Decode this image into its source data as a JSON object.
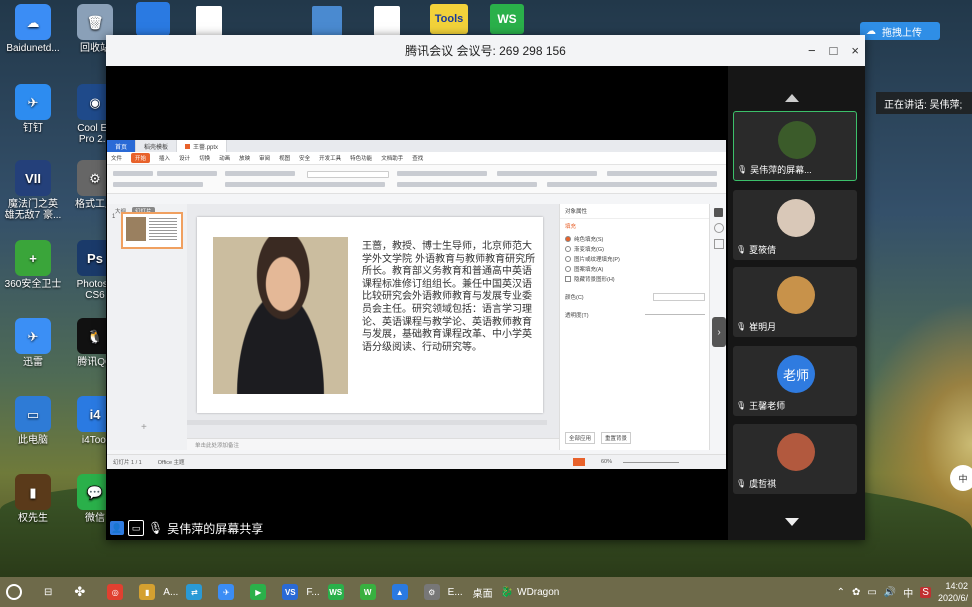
{
  "desktop": {
    "top_partial_icons": [
      "Tools",
      "WS"
    ],
    "icons": [
      {
        "name": "baidunetdisk",
        "label": "Baidunetd...",
        "color": "#3b8df5",
        "glyph": "☁"
      },
      {
        "name": "recycle-bin",
        "label": "回收站",
        "color": "#8aa0b8",
        "glyph": "🗑"
      },
      {
        "name": "dingding",
        "label": "钉钉",
        "color": "#2d8cf0",
        "glyph": "✈"
      },
      {
        "name": "cooledit",
        "label": "Cool Ed\nPro 2.1",
        "color": "#1f4a8a",
        "glyph": "◉"
      },
      {
        "name": "magic-gate",
        "label": "魔法门之英\n雄无敌7 豪...",
        "color": "#24407a",
        "glyph": "VII"
      },
      {
        "name": "format-factory",
        "label": "格式工厂",
        "color": "#666",
        "glyph": "⚙"
      },
      {
        "name": "360-safe",
        "label": "360安全卫士",
        "color": "#3aa53a",
        "glyph": "+"
      },
      {
        "name": "photoshop",
        "label": "Photosh\nCS6",
        "color": "#1a3a6a",
        "glyph": "Ps"
      },
      {
        "name": "xunlei",
        "label": "迅雷",
        "color": "#3b8ff5",
        "glyph": "✈"
      },
      {
        "name": "tencent-qq",
        "label": "腾讯QQ",
        "color": "#111",
        "glyph": "🐧"
      },
      {
        "name": "this-pc",
        "label": "此电脑",
        "color": "#2e7bd6",
        "glyph": "▭"
      },
      {
        "name": "i4tools",
        "label": "i4Tool",
        "color": "#2a7ae2",
        "glyph": "i4"
      },
      {
        "name": "quanxiansheng",
        "label": "权先生",
        "color": "#5a3a1a",
        "glyph": "▮"
      },
      {
        "name": "wechat",
        "label": "微信",
        "color": "#2ab04a",
        "glyph": "💬"
      }
    ],
    "upload_label": "拖拽上传",
    "speaking_text": "正在讲话: 吴伟萍;"
  },
  "meeting": {
    "title": "腾讯会议 会议号: 269 298 156",
    "window_buttons": [
      "?",
      "−",
      "□",
      "×"
    ],
    "share_label": "吴伟萍的屏幕共享",
    "participants": [
      {
        "name": "吴伟萍的屏幕...",
        "avatar_color": "#3b5b2a",
        "avatar_text": "",
        "active": true
      },
      {
        "name": "夏筱倩",
        "avatar_color": "#d9c8b8",
        "avatar_text": ""
      },
      {
        "name": "崔明月",
        "avatar_color": "#c8924a",
        "avatar_text": ""
      },
      {
        "name": "王馨老师",
        "avatar_color": "#2f7be0",
        "avatar_text": "老师"
      },
      {
        "name": "虞哲祺",
        "avatar_color": "#b2593e",
        "avatar_text": ""
      }
    ]
  },
  "wps": {
    "tabs": [
      "首页",
      "稻壳模板",
      "王蔷.pptx"
    ],
    "menu": [
      "文件",
      "开始",
      "插入",
      "设计",
      "切换",
      "动画",
      "放映",
      "审阅",
      "视图",
      "安全",
      "开发工具",
      "特色功能",
      "文档助手",
      "查找"
    ],
    "menu_active": "开始",
    "outline_tabs": [
      "大纲",
      "幻灯片"
    ],
    "slide_number": "1",
    "slide_bio": "王蔷，教授、博士生导师，北京师范大学外文学院 外语教育与教师教育研究所所长。教育部义务教育和普通高中英语课程标准修订组组长。兼任中国英汉语比较研究会外语教师教育与发展专业委员会主任。研究领域包括：语言学习理论、英语课程与教学论、英语教师教育与发展，基础教育课程改革、中小学英语分级阅读、行动研究等。",
    "side_panel": {
      "title": "对象属性",
      "section": "填充",
      "options": [
        "纯色填充(S)",
        "渐变填充(G)",
        "图片或纹理填充(P)",
        "图案填充(A)",
        "隐藏背景图形(H)"
      ],
      "labels": [
        "颜色(C)",
        "透明度(T)"
      ],
      "buttons": [
        "全部应用",
        "重置背景"
      ]
    },
    "notes_placeholder": "单击此处添加备注",
    "status_left": "幻灯片 1 / 1",
    "status_theme": "Office 主题",
    "zoom": "60%"
  },
  "taskbar": {
    "apps": [
      {
        "label": "",
        "color": "#e04030",
        "glyph": "◎"
      },
      {
        "label": "A...",
        "color": "#d4a030",
        "glyph": "▮"
      },
      {
        "label": "",
        "color": "#2a9ad6",
        "glyph": "⇄"
      },
      {
        "label": "",
        "color": "#3b8df5",
        "glyph": "✈"
      },
      {
        "label": "",
        "color": "#2ab04a",
        "glyph": "▶"
      },
      {
        "label": "F...",
        "color": "#2a6ad6",
        "glyph": "VS"
      },
      {
        "label": "",
        "color": "#2ab04a",
        "glyph": "WS"
      },
      {
        "label": "",
        "color": "#38b040",
        "glyph": "W"
      },
      {
        "label": "",
        "color": "#2a7ae2",
        "glyph": "▲"
      },
      {
        "label": "E...",
        "color": "#777",
        "glyph": "⚙"
      }
    ],
    "desktop_label": "桌面",
    "wdragon_label": "WDragon",
    "tray_ime": "中",
    "time": "14:02",
    "date": "2020/6/"
  }
}
